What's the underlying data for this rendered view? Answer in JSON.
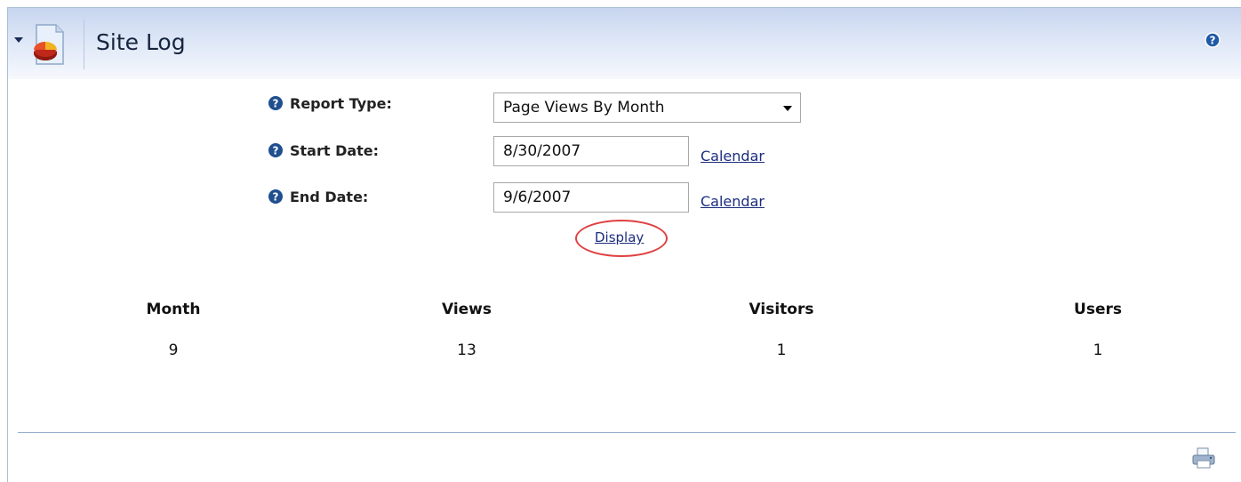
{
  "module": {
    "title": "Site Log"
  },
  "form": {
    "report_type_label": "Report Type:",
    "report_type_value": "Page Views By Month",
    "start_date_label": "Start Date:",
    "start_date_value": "8/30/2007",
    "end_date_label": "End Date:",
    "end_date_value": "9/6/2007",
    "calendar_link": "Calendar",
    "display_link": "Display"
  },
  "table": {
    "headers": [
      "Month",
      "Views",
      "Visitors",
      "Users"
    ],
    "rows": [
      [
        "9",
        "13",
        "1",
        "1"
      ]
    ]
  },
  "icons": {
    "collapse": "chevron-down-icon",
    "module": "pie-chart-icon",
    "help": "help-icon",
    "print": "print-icon"
  },
  "colors": {
    "title_text": "#16253f",
    "link": "#1c2d7f",
    "highlight_oval": "#e04040",
    "help_icon": "#1f5aa6"
  }
}
